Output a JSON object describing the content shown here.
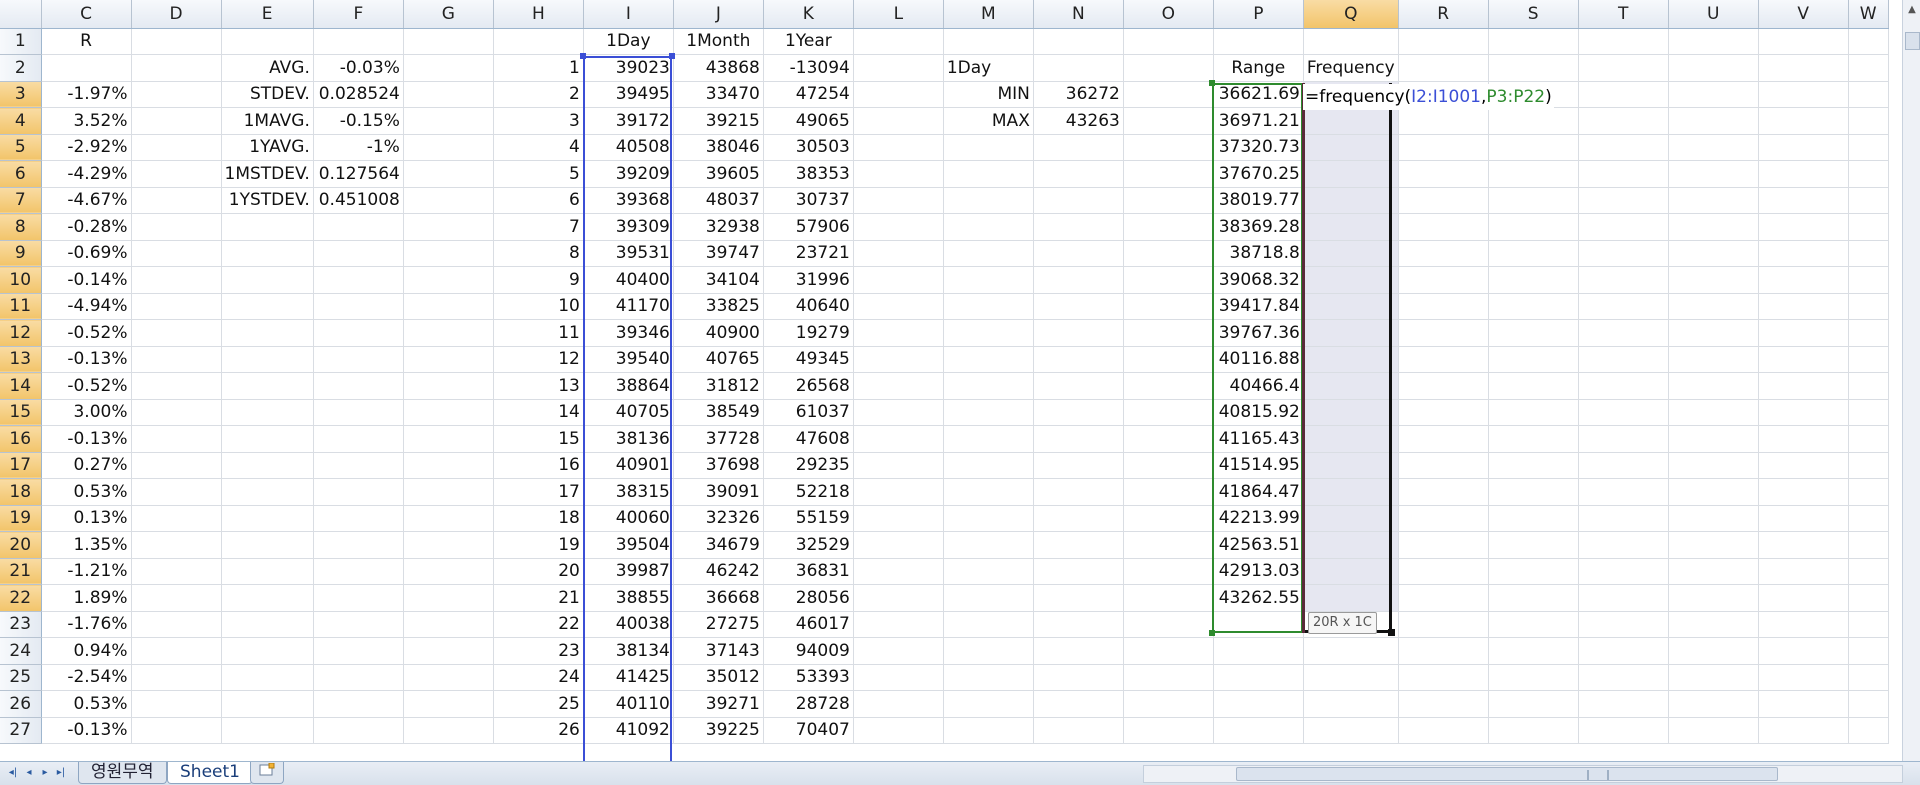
{
  "columns": [
    "C",
    "D",
    "E",
    "F",
    "G",
    "H",
    "I",
    "J",
    "K",
    "L",
    "M",
    "N",
    "O",
    "P",
    "Q",
    "R",
    "S",
    "T",
    "U",
    "V",
    "W"
  ],
  "selected_column": "Q",
  "selected_rows": [
    "3",
    "4",
    "5",
    "6",
    "7",
    "8",
    "9",
    "10",
    "11",
    "12",
    "13",
    "14",
    "15",
    "16",
    "17",
    "18",
    "19",
    "20",
    "21",
    "22"
  ],
  "rows": [
    {
      "n": "1",
      "C": "R",
      "D": "",
      "E": "",
      "F": "",
      "H": "",
      "I": "1Day",
      "J": "1Month",
      "K": "1Year",
      "M": "",
      "N": "",
      "P": "",
      "Q": ""
    },
    {
      "n": "2",
      "C": "",
      "D": "",
      "E": "AVG.",
      "F": "-0.03%",
      "H": "1",
      "I": "39023",
      "J": "43868",
      "K": "-13094",
      "M": "1Day",
      "N": "",
      "P": "Range",
      "Q": "Frequency"
    },
    {
      "n": "3",
      "C": "-1.97%",
      "D": "",
      "E": "STDEV.",
      "F": "0.028524",
      "H": "2",
      "I": "39495",
      "J": "33470",
      "K": "47254",
      "M": "MIN",
      "N": "36272",
      "P": "36621.69",
      "Q": ""
    },
    {
      "n": "4",
      "C": "3.52%",
      "D": "",
      "E": "1MAVG.",
      "F": "-0.15%",
      "H": "3",
      "I": "39172",
      "J": "39215",
      "K": "49065",
      "M": "MAX",
      "N": "43263",
      "P": "36971.21",
      "Q": ""
    },
    {
      "n": "5",
      "C": "-2.92%",
      "D": "",
      "E": "1YAVG.",
      "F": "-1%",
      "H": "4",
      "I": "40508",
      "J": "38046",
      "K": "30503",
      "M": "",
      "N": "",
      "P": "37320.73",
      "Q": ""
    },
    {
      "n": "6",
      "C": "-4.29%",
      "D": "",
      "E": "1MSTDEV.",
      "F": "0.127564",
      "H": "5",
      "I": "39209",
      "J": "39605",
      "K": "38353",
      "M": "",
      "N": "",
      "P": "37670.25",
      "Q": ""
    },
    {
      "n": "7",
      "C": "-4.67%",
      "D": "",
      "E": "1YSTDEV.",
      "F": "0.451008",
      "H": "6",
      "I": "39368",
      "J": "48037",
      "K": "30737",
      "M": "",
      "N": "",
      "P": "38019.77",
      "Q": ""
    },
    {
      "n": "8",
      "C": "-0.28%",
      "D": "",
      "E": "",
      "F": "",
      "H": "7",
      "I": "39309",
      "J": "32938",
      "K": "57906",
      "M": "",
      "N": "",
      "P": "38369.28",
      "Q": ""
    },
    {
      "n": "9",
      "C": "-0.69%",
      "D": "",
      "E": "",
      "F": "",
      "H": "8",
      "I": "39531",
      "J": "39747",
      "K": "23721",
      "M": "",
      "N": "",
      "P": "38718.8",
      "Q": ""
    },
    {
      "n": "10",
      "C": "-0.14%",
      "D": "",
      "E": "",
      "F": "",
      "H": "9",
      "I": "40400",
      "J": "34104",
      "K": "31996",
      "M": "",
      "N": "",
      "P": "39068.32",
      "Q": ""
    },
    {
      "n": "11",
      "C": "-4.94%",
      "D": "",
      "E": "",
      "F": "",
      "H": "10",
      "I": "41170",
      "J": "33825",
      "K": "40640",
      "M": "",
      "N": "",
      "P": "39417.84",
      "Q": ""
    },
    {
      "n": "12",
      "C": "-0.52%",
      "D": "",
      "E": "",
      "F": "",
      "H": "11",
      "I": "39346",
      "J": "40900",
      "K": "19279",
      "M": "",
      "N": "",
      "P": "39767.36",
      "Q": ""
    },
    {
      "n": "13",
      "C": "-0.13%",
      "D": "",
      "E": "",
      "F": "",
      "H": "12",
      "I": "39540",
      "J": "40765",
      "K": "49345",
      "M": "",
      "N": "",
      "P": "40116.88",
      "Q": ""
    },
    {
      "n": "14",
      "C": "-0.52%",
      "D": "",
      "E": "",
      "F": "",
      "H": "13",
      "I": "38864",
      "J": "31812",
      "K": "26568",
      "M": "",
      "N": "",
      "P": "40466.4",
      "Q": ""
    },
    {
      "n": "15",
      "C": "3.00%",
      "D": "",
      "E": "",
      "F": "",
      "H": "14",
      "I": "40705",
      "J": "38549",
      "K": "61037",
      "M": "",
      "N": "",
      "P": "40815.92",
      "Q": ""
    },
    {
      "n": "16",
      "C": "-0.13%",
      "D": "",
      "E": "",
      "F": "",
      "H": "15",
      "I": "38136",
      "J": "37728",
      "K": "47608",
      "M": "",
      "N": "",
      "P": "41165.43",
      "Q": ""
    },
    {
      "n": "17",
      "C": "0.27%",
      "D": "",
      "E": "",
      "F": "",
      "H": "16",
      "I": "40901",
      "J": "37698",
      "K": "29235",
      "M": "",
      "N": "",
      "P": "41514.95",
      "Q": ""
    },
    {
      "n": "18",
      "C": "0.53%",
      "D": "",
      "E": "",
      "F": "",
      "H": "17",
      "I": "38315",
      "J": "39091",
      "K": "52218",
      "M": "",
      "N": "",
      "P": "41864.47",
      "Q": ""
    },
    {
      "n": "19",
      "C": "0.13%",
      "D": "",
      "E": "",
      "F": "",
      "H": "18",
      "I": "40060",
      "J": "32326",
      "K": "55159",
      "M": "",
      "N": "",
      "P": "42213.99",
      "Q": ""
    },
    {
      "n": "20",
      "C": "1.35%",
      "D": "",
      "E": "",
      "F": "",
      "H": "19",
      "I": "39504",
      "J": "34679",
      "K": "32529",
      "M": "",
      "N": "",
      "P": "42563.51",
      "Q": ""
    },
    {
      "n": "21",
      "C": "-1.21%",
      "D": "",
      "E": "",
      "F": "",
      "H": "20",
      "I": "39987",
      "J": "46242",
      "K": "36831",
      "M": "",
      "N": "",
      "P": "42913.03",
      "Q": ""
    },
    {
      "n": "22",
      "C": "1.89%",
      "D": "",
      "E": "",
      "F": "",
      "H": "21",
      "I": "38855",
      "J": "36668",
      "K": "28056",
      "M": "",
      "N": "",
      "P": "43262.55",
      "Q": ""
    },
    {
      "n": "23",
      "C": "-1.76%",
      "D": "",
      "E": "",
      "F": "",
      "H": "22",
      "I": "40038",
      "J": "27275",
      "K": "46017",
      "M": "",
      "N": "",
      "P": "",
      "Q": ""
    },
    {
      "n": "24",
      "C": "0.94%",
      "D": "",
      "E": "",
      "F": "",
      "H": "23",
      "I": "38134",
      "J": "37143",
      "K": "94009",
      "M": "",
      "N": "",
      "P": "",
      "Q": ""
    },
    {
      "n": "25",
      "C": "-2.54%",
      "D": "",
      "E": "",
      "F": "",
      "H": "24",
      "I": "41425",
      "J": "35012",
      "K": "53393",
      "M": "",
      "N": "",
      "P": "",
      "Q": ""
    },
    {
      "n": "26",
      "C": "0.53%",
      "D": "",
      "E": "",
      "F": "",
      "H": "25",
      "I": "40110",
      "J": "39271",
      "K": "28728",
      "M": "",
      "N": "",
      "P": "",
      "Q": ""
    },
    {
      "n": "27",
      "C": "-0.13%",
      "D": "",
      "E": "",
      "F": "",
      "H": "26",
      "I": "41092",
      "J": "39225",
      "K": "70407",
      "M": "",
      "N": "",
      "P": "",
      "Q": ""
    }
  ],
  "formula": {
    "prefix": "=frequency(",
    "ref1": "I2:I1001",
    "sep": ",",
    "ref2": "P3:P22",
    "suffix": ")",
    "ref1_color": "#3b4fd6",
    "ref2_color": "#2e8b2e"
  },
  "size_tooltip": "20R x 1C",
  "sheet_tabs": [
    {
      "label": "영원무역",
      "active": false
    },
    {
      "label": "Sheet1",
      "active": true
    }
  ],
  "colors": {
    "header_selected": "#f2c46a",
    "range_blue": "#3b4fd6",
    "range_green": "#2e8b2e",
    "selection_fill": "#e6e7f1"
  }
}
